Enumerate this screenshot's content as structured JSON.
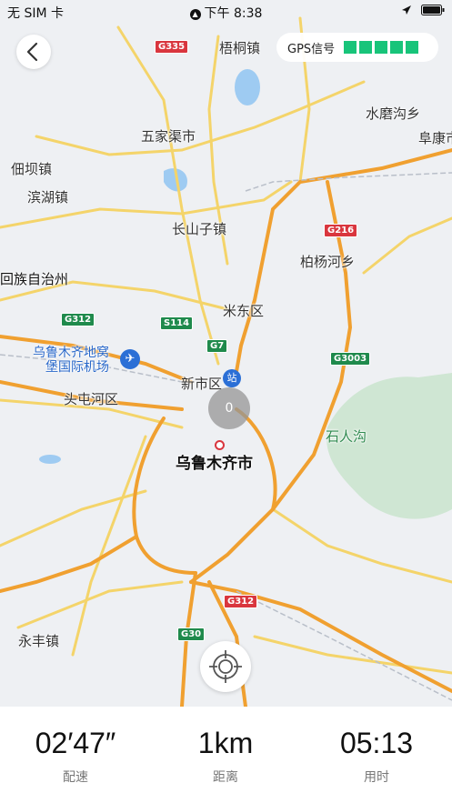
{
  "status_bar": {
    "carrier": "无 SIM 卡",
    "time": "下午 8:38"
  },
  "gps": {
    "label": "GPS信号",
    "bars": 5,
    "bar_color": "#18c47a"
  },
  "map": {
    "cluster_count": "0",
    "places": {
      "wutong": "梧桐镇",
      "wujiaqu": "五家渠市",
      "shuimogou": "水磨沟乡",
      "fukang": "阜康市",
      "dianba": "佃坝镇",
      "binhu": "滨湖镇",
      "changshanzi": "长山子镇",
      "baiyanghe": "柏杨河乡",
      "huizu": "回族自治州",
      "midong": "米东区",
      "airport_1": "乌鲁木齐地窝",
      "airport_2": "堡国际机场",
      "xinshi": "新市区",
      "toutunhe": "头屯河区",
      "shirengou": "石人沟",
      "urumqi": "乌鲁木齐市",
      "yongfeng": "永丰镇"
    },
    "roads": {
      "g335": "G335",
      "g216": "G216",
      "g312a": "G312",
      "s114": "S114",
      "g7": "G7",
      "g3003": "G3003",
      "g312b": "G312",
      "g30": "G30"
    }
  },
  "stats": [
    {
      "value": "02′47″",
      "label": "配速"
    },
    {
      "value": "1km",
      "label": "距离"
    },
    {
      "value": "05:13",
      "label": "用时"
    }
  ]
}
